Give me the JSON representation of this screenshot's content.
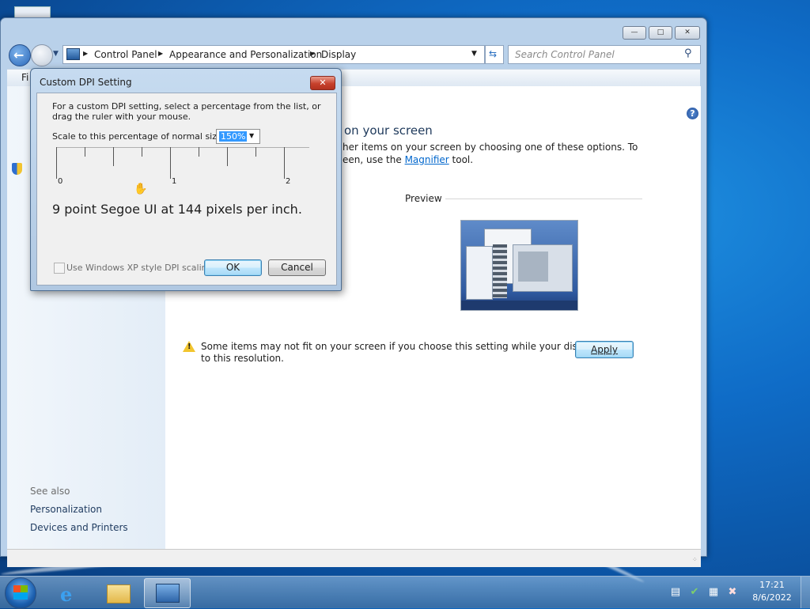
{
  "window": {
    "breadcrumb": [
      "Control Panel",
      "Appearance and Personalization",
      "Display"
    ],
    "search_placeholder": "Search Control Panel",
    "menu_first_letter": "Fi",
    "controls": {
      "minimize": "—",
      "maximize": "□",
      "close": "✕"
    }
  },
  "display_page": {
    "heading": "on your screen",
    "description_line1": "her items on your screen by choosing one of these options. To",
    "description_line2_prefix": "een, use the ",
    "magnifier_link": "Magnifier",
    "description_line2_suffix": " tool.",
    "preview_label": "Preview",
    "warning_line1": "Some items may not fit on your screen if you choose this setting while your display is set",
    "warning_line2": "to this resolution.",
    "apply_button": "Apply"
  },
  "left_pane": {
    "see_also_label": "See also",
    "links": [
      "Personalization",
      "Devices and Printers"
    ]
  },
  "dialog": {
    "title": "Custom DPI Setting",
    "close_label": "✕",
    "intro_line1": "For a custom DPI setting, select a percentage from the list, or",
    "intro_line2": "drag the ruler with your mouse.",
    "scale_label": "Scale to this percentage of normal size:",
    "scale_value": "150%",
    "ruler_labels": [
      "0",
      "1",
      "2"
    ],
    "sample_text": "9 point Segoe UI at 144 pixels per inch.",
    "xp_checkbox_label": "Use Windows XP style DPI scaling",
    "xp_checkbox_checked": false,
    "ok_button": "OK",
    "cancel_button": "Cancel"
  },
  "taskbar": {
    "clock_time": "17:21",
    "clock_date": "8/6/2022",
    "pinned": [
      "start-button",
      "internet-explorer",
      "windows-explorer",
      "control-panel"
    ]
  }
}
